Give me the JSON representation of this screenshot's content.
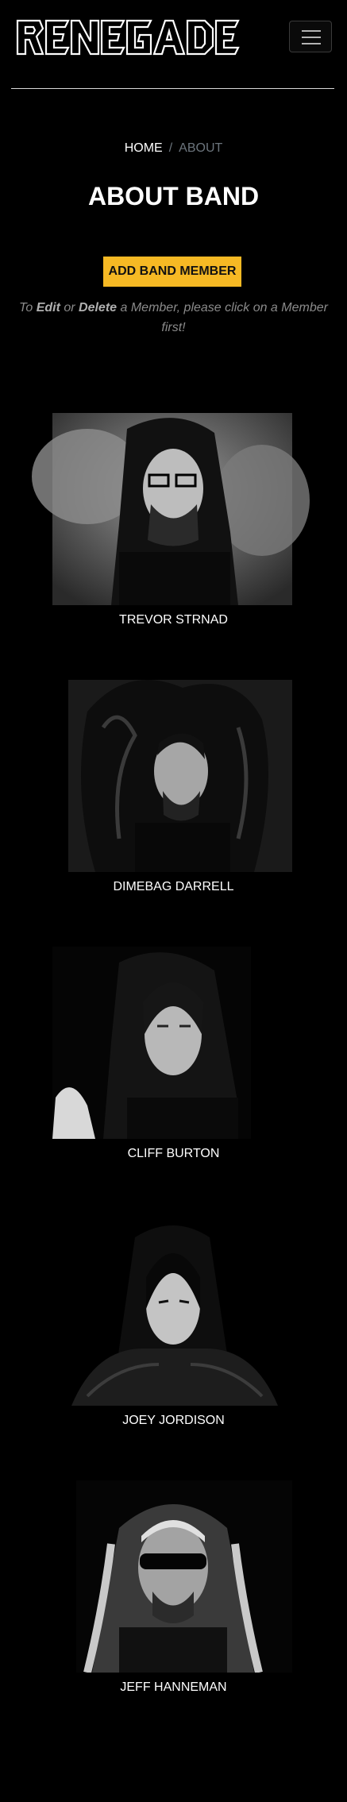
{
  "brand": {
    "logo_text": "RENEGADE"
  },
  "nav": {
    "toggle_icon": "hamburger-icon"
  },
  "breadcrumb": {
    "home": "HOME",
    "separator": "/",
    "current": "ABOUT"
  },
  "page": {
    "title": "ABOUT BAND"
  },
  "actions": {
    "add_member": "ADD BAND MEMBER"
  },
  "hint": {
    "prefix": "To ",
    "edit": "Edit",
    "middle": " or ",
    "delete": "Delete",
    "suffix": " a Member, please click on a Member first!"
  },
  "members": [
    {
      "name": "TREVOR STRNAD"
    },
    {
      "name": "DIMEBAG DARRELL"
    },
    {
      "name": "CLIFF BURTON"
    },
    {
      "name": "JOEY JORDISON"
    },
    {
      "name": "JEFF HANNEMAN"
    }
  ],
  "colors": {
    "background": "#000000",
    "accent": "#f6b924",
    "muted": "#6c757d",
    "divider": "#d9d9d9"
  }
}
